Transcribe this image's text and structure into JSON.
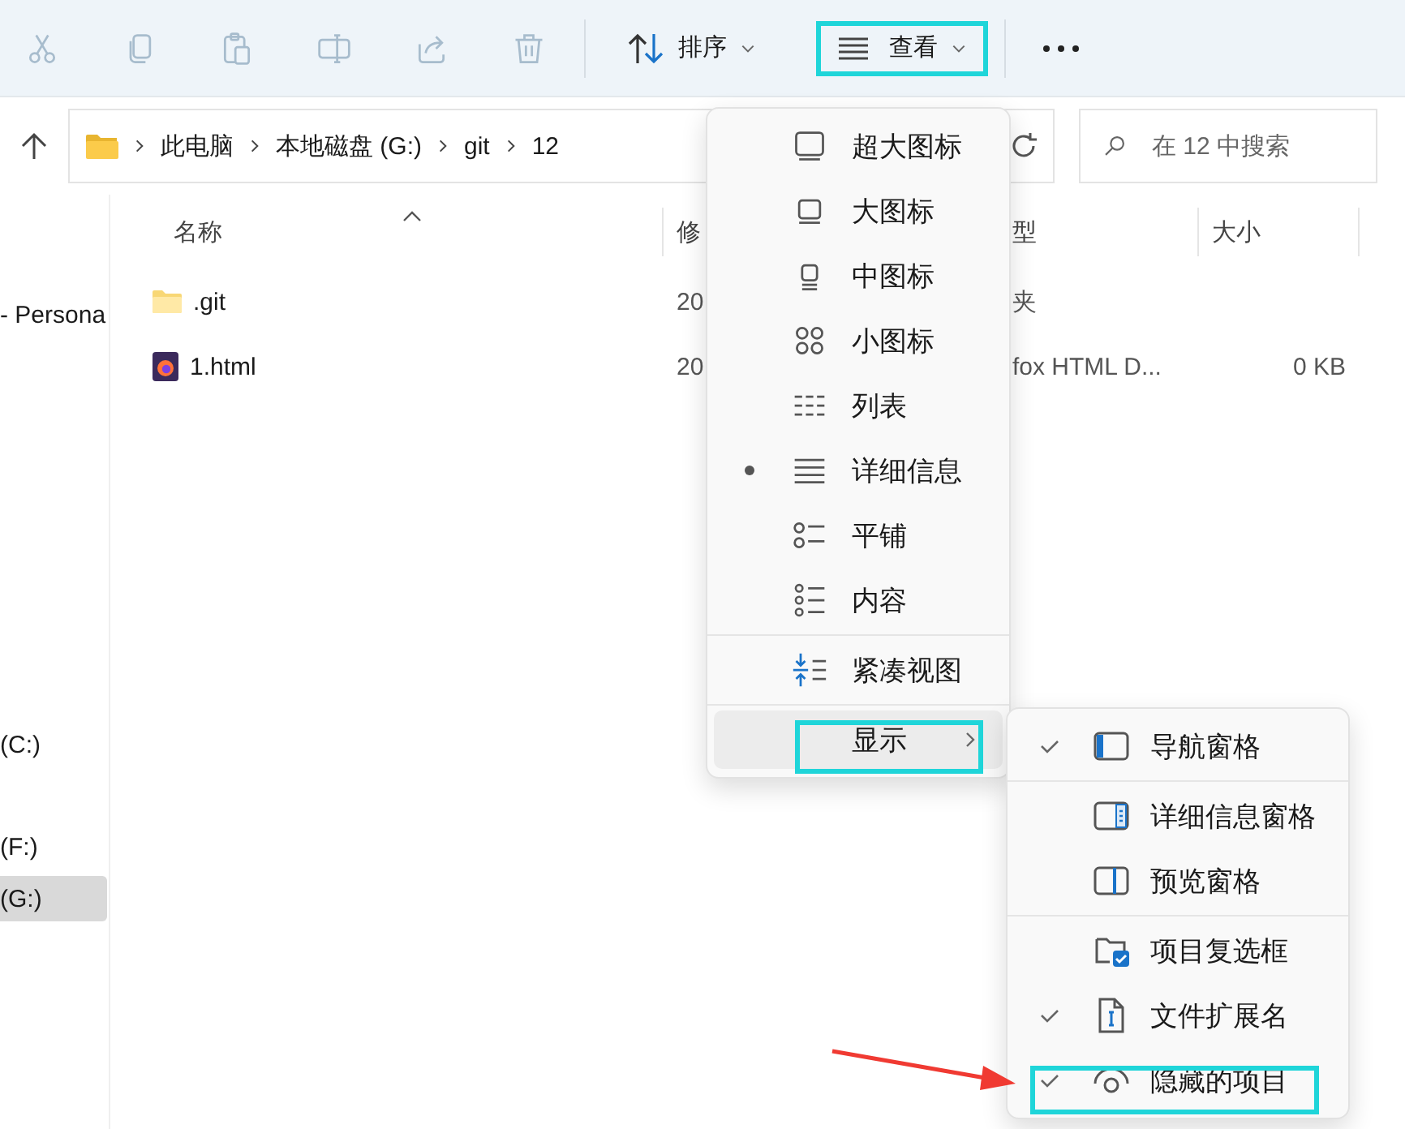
{
  "toolbar": {
    "actions": [
      {
        "kind": "cut",
        "disabled": true
      },
      {
        "kind": "copy",
        "disabled": true
      },
      {
        "kind": "paste",
        "disabled": true
      },
      {
        "kind": "rename",
        "disabled": true
      },
      {
        "kind": "share",
        "disabled": true
      },
      {
        "kind": "delete",
        "disabled": true
      }
    ],
    "sort_button": {
      "label": "排序"
    },
    "view_button": {
      "label": "查看",
      "annotated": true
    }
  },
  "address_bar": {
    "path": [
      "此电脑",
      "本地磁盘 (G:)",
      "git",
      "12"
    ]
  },
  "search": {
    "placeholder": "在 12 中搜索"
  },
  "sidebar": {
    "items": [
      {
        "label": "- Persona",
        "selected": false
      },
      {
        "label": "(C:)",
        "selected": false
      },
      {
        "label": "(F:)",
        "selected": false
      },
      {
        "label": "(G:)",
        "selected": true
      }
    ]
  },
  "file_list": {
    "columns": [
      {
        "label": "名称",
        "sorted": true
      },
      {
        "label": "修",
        "sorted": false
      },
      {
        "label": "型",
        "sorted": false
      },
      {
        "label": "大小",
        "sorted": false
      }
    ],
    "rows": [
      {
        "kind": "folder",
        "name": ".git",
        "modified": "20",
        "type": "夹"
      },
      {
        "kind": "html",
        "name": "1.html",
        "modified": "20",
        "type": "fox HTML D...",
        "size": "0 KB"
      }
    ]
  },
  "view_menu": {
    "items": [
      {
        "kind": "option",
        "label": "超大图标",
        "selected": false
      },
      {
        "kind": "option",
        "label": "大图标",
        "selected": false
      },
      {
        "kind": "option",
        "label": "中图标",
        "selected": false
      },
      {
        "kind": "option",
        "label": "小图标",
        "selected": false
      },
      {
        "kind": "option",
        "label": "列表",
        "selected": false
      },
      {
        "kind": "option",
        "label": "详细信息",
        "selected": true
      },
      {
        "kind": "option",
        "label": "平铺",
        "selected": false
      },
      {
        "kind": "option",
        "label": "内容",
        "selected": false
      },
      {
        "kind": "divider"
      },
      {
        "kind": "action",
        "label": "紧凑视图"
      },
      {
        "kind": "divider"
      },
      {
        "kind": "submenu",
        "label": "显示",
        "highlighted": true,
        "annotated": true
      }
    ]
  },
  "show_submenu": {
    "items": [
      {
        "kind": "toggle",
        "label": "导航窗格",
        "checked": true,
        "annotated": false
      },
      {
        "kind": "divider"
      },
      {
        "kind": "toggle",
        "label": "详细信息窗格",
        "checked": false,
        "annotated": false
      },
      {
        "kind": "toggle",
        "label": "预览窗格",
        "checked": false,
        "annotated": false
      },
      {
        "kind": "divider"
      },
      {
        "kind": "toggle",
        "label": "项目复选框",
        "checked": false,
        "annotated": false
      },
      {
        "kind": "toggle",
        "label": "文件扩展名",
        "checked": true,
        "annotated": false
      },
      {
        "kind": "toggle",
        "label": "隐藏的项目",
        "checked": true,
        "annotated": true
      }
    ]
  }
}
